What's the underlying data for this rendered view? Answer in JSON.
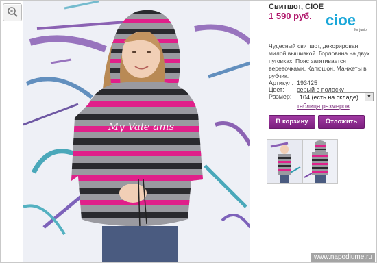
{
  "product": {
    "title": "Свитшот, CIOE",
    "price": "1 590 руб.",
    "brand_logo_text": "cioe",
    "brand_sub_text": "for junior",
    "description": "Чудесный свитшот, декорирован милой вышивкой. Горловина на двух пуговках. Пояс затягивается веревочками. Капюшон. Манжеты в рубчик.",
    "specs": {
      "article_label": "Артикул:",
      "article_value": "193425",
      "color_label": "Цвет:",
      "color_value": "серый в полоску",
      "size_label": "Размер:",
      "size_selected": "104 (есть на складе)",
      "size_table_link": "таблица размеров"
    },
    "buttons": {
      "cart": "В корзину",
      "postpone": "Отложить"
    },
    "sweater_print": "My Vale ams"
  },
  "watermark": "www.napodiume.ru",
  "colors": {
    "price": "#b0166b",
    "button": "#8a2a8c",
    "brand": "#1aa7d9",
    "stripe_pink": "#e0208a",
    "stripe_dark": "#2a2a2e",
    "stripe_gray": "#9a9aa0"
  },
  "icons": {
    "zoom": "magnifier-icon",
    "select_arrow": "chevron-down-icon"
  }
}
